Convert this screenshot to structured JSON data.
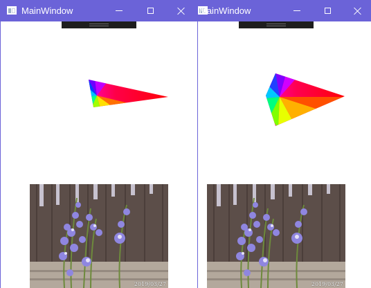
{
  "windows": [
    {
      "title": "MainWindow",
      "photo_timestamp": "2019/03/27"
    },
    {
      "title": "MainWindow",
      "photo_timestamp": "2019/03/27"
    }
  ],
  "colors": {
    "titlebar": "#6b63d8",
    "debug_bar": "#1e1e1e"
  },
  "icons": {
    "minimize": "minimize-icon",
    "maximize": "maximize-icon",
    "close": "close-icon"
  }
}
